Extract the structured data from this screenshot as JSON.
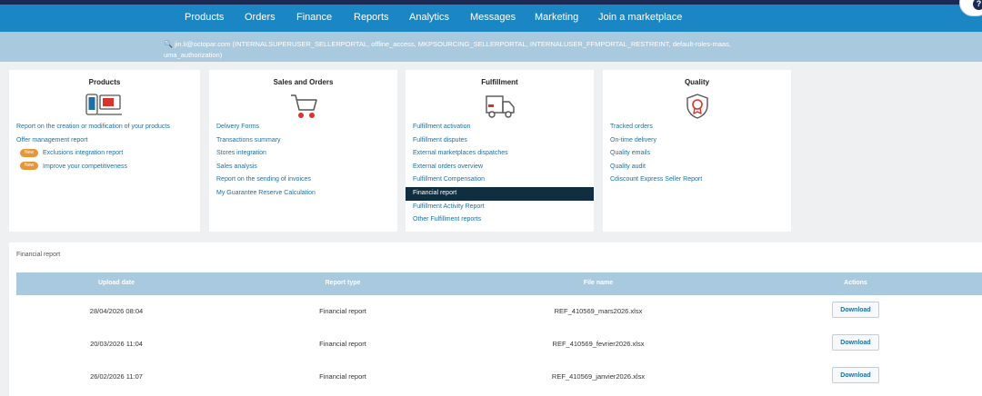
{
  "nav": {
    "items": [
      {
        "label": "Products"
      },
      {
        "label": "Orders"
      },
      {
        "label": "Finance"
      },
      {
        "label": "Reports"
      },
      {
        "label": "Analytics"
      },
      {
        "label": "Messages"
      },
      {
        "label": "Marketing"
      },
      {
        "label": "Join a marketplace"
      }
    ],
    "help_glyph": "?"
  },
  "user_bar": {
    "search_glyph": "🔍",
    "text": "jin.li@octopar.com (INTERNALSUPERUSER_SELLERPORTAL, offline_access, MKPSOURCING_SELLERPORTAL, INTERNALUSER_FFMPORTAL_RESTREINT, default-roles-maas, uma_authorization)"
  },
  "cards": {
    "products": {
      "title": "Products",
      "icon": "devices-icon",
      "links": [
        {
          "label": "Report on the creation or modification of your products"
        },
        {
          "label": "Offer management report"
        },
        {
          "label": "Exclusions integration report",
          "badge": "New"
        },
        {
          "label": "Improve your competitiveness",
          "badge": "New"
        }
      ]
    },
    "sales": {
      "title": "Sales and Orders",
      "icon": "cart-icon",
      "links": [
        {
          "label": "Delivery Forms"
        },
        {
          "label": "Transactions summary"
        },
        {
          "label": "Stores integration"
        },
        {
          "label": "Sales analysis"
        },
        {
          "label": "Report on the sending of invoices"
        },
        {
          "label": "My Guarantee Reserve Calculation"
        }
      ]
    },
    "fulfillment": {
      "title": "Fulfillment",
      "icon": "truck-icon",
      "links": [
        {
          "label": "Fulfillment activation"
        },
        {
          "label": "Fulfillment disputes"
        },
        {
          "label": "External marketplaces dispatches"
        },
        {
          "label": "External orders overview"
        },
        {
          "label": "Fulfillment Compensation"
        },
        {
          "label": "Financial report"
        },
        {
          "label": "Fulfillment Activity Report"
        },
        {
          "label": "Other Fulfillment reports"
        }
      ]
    },
    "quality": {
      "title": "Quality",
      "icon": "shield-badge-icon",
      "links": [
        {
          "label": "Tracked orders"
        },
        {
          "label": "On-time delivery"
        },
        {
          "label": "Quality emails"
        },
        {
          "label": "Quality audit"
        },
        {
          "label": "Cdiscount Express Seller Report"
        }
      ]
    }
  },
  "colors": {
    "nav_blue": "#1a87c4",
    "light_blue": "#a9c9de",
    "selected_dark": "#0f2e40",
    "badge_orange": "#e5963a",
    "icon_red": "#d9342b"
  },
  "report": {
    "title": "Financial report",
    "columns": [
      "Upload date",
      "Report type",
      "File name",
      "Actions"
    ],
    "rows": [
      {
        "date": "28/04/2026 08:04",
        "type": "Financial report",
        "file": "REF_410569_mars2026.xlsx",
        "action": "Download"
      },
      {
        "date": "20/03/2026 11:04",
        "type": "Financial report",
        "file": "REF_410569_fevrier2026.xlsx",
        "action": "Download"
      },
      {
        "date": "26/02/2026 11:07",
        "type": "Financial report",
        "file": "REF_410569_janvier2026.xlsx",
        "action": "Download"
      }
    ]
  }
}
